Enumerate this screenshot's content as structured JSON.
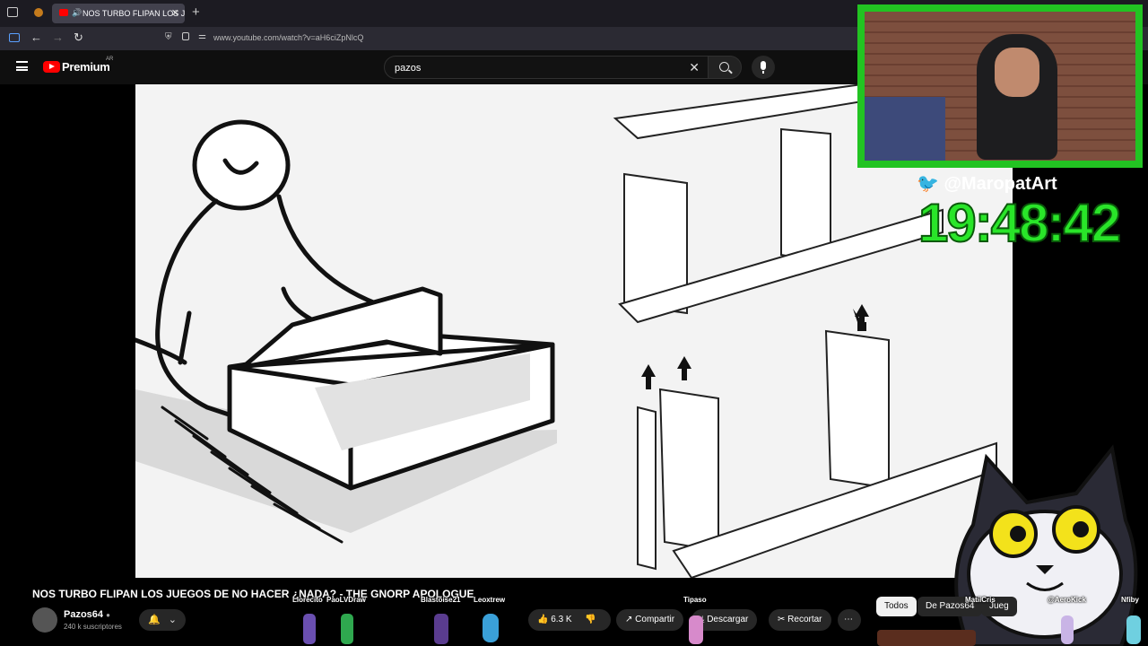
{
  "browser": {
    "tab_title": "NOS TURBO FLIPAN LOS JUEG",
    "url": "www.youtube.com/watch?v=aH6ciZpNlcQ"
  },
  "youtube": {
    "logo_text": "Premium",
    "region": "AR",
    "search_value": "pazos"
  },
  "video": {
    "title": "NOS TURBO FLIPAN LOS JUEGOS DE NO HACER ¿NADA? - THE GNORP APOLOGUE"
  },
  "channel": {
    "name": "Pazos64",
    "subscribers": "240 k suscriptores"
  },
  "actions": {
    "likes": "6.3 K",
    "share": "Compartir",
    "download": "Descargar",
    "clip": "Recortar"
  },
  "chips": {
    "all": "Todos",
    "from_channel": "De Pazos64",
    "partial": "Jueg"
  },
  "overlay": {
    "handle": "@MaropatArt",
    "clock": "19:48:42",
    "chatters": [
      "Llorecito",
      "PaoLVDraw",
      "Blastoise21",
      "Leoxtrew",
      "Tipaso",
      "MatiiCris",
      "@AeroKick",
      "Nfiby"
    ]
  },
  "colors": {
    "brand_red": "#ff0000",
    "frame_green": "#22c322",
    "clock_green": "#29e529"
  }
}
